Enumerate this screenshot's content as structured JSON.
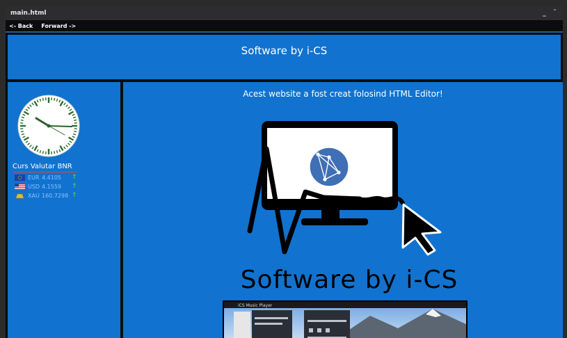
{
  "window": {
    "title": "main.html"
  },
  "nav": {
    "back": "<- Back",
    "forward": "Forward ->"
  },
  "header": {
    "title": "Software by i-CS"
  },
  "sidebar": {
    "curs_title": "Curs Valutar BNR",
    "rates": [
      {
        "currency": "EUR",
        "value": "4.4105",
        "flag": "eu-flag-icon"
      },
      {
        "currency": "USD",
        "value": "4.1559",
        "flag": "us-flag-icon"
      },
      {
        "currency": "XAU",
        "value": "160.7298",
        "flag": "gold-bar-icon"
      }
    ]
  },
  "main": {
    "heading": "Acest website a fost creat folosind HTML Editor!",
    "logo_text": "Software by i-CS",
    "screenshot_title": "iCS Music Player"
  },
  "colors": {
    "accent": "#1173cf",
    "dark": "#0b0b0b",
    "up_arrow": "#4ec94e"
  }
}
